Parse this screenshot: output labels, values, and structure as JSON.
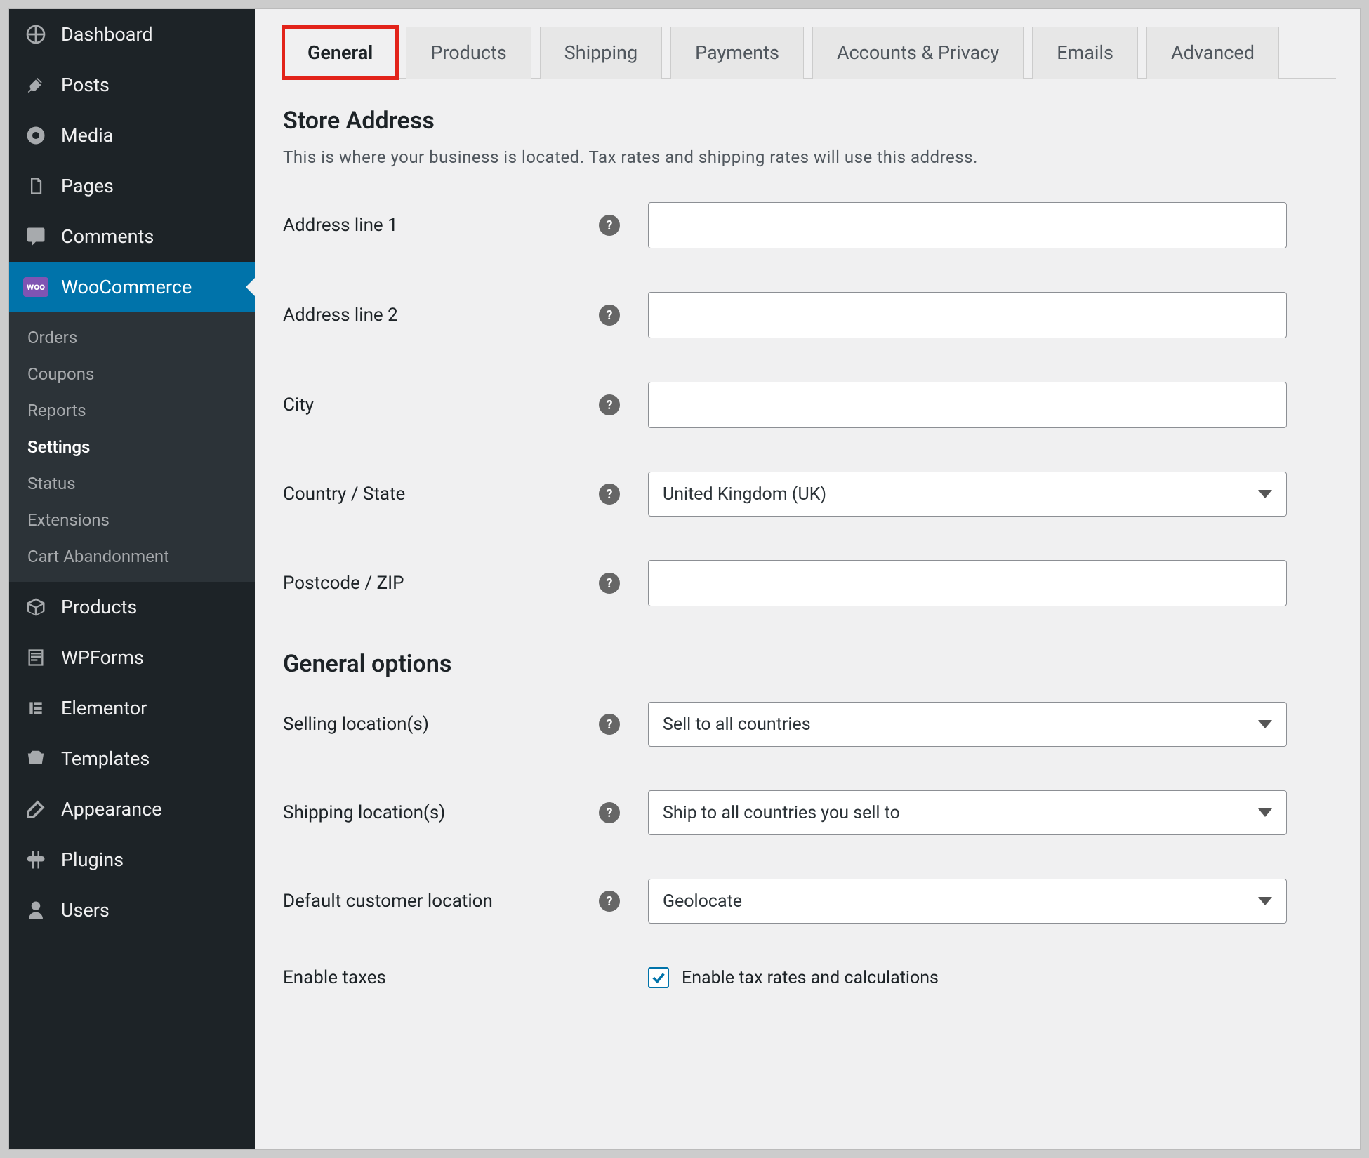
{
  "sidebar": {
    "items": [
      {
        "icon": "dashboard",
        "label": "Dashboard"
      },
      {
        "icon": "pin",
        "label": "Posts"
      },
      {
        "icon": "media",
        "label": "Media"
      },
      {
        "icon": "pages",
        "label": "Pages"
      },
      {
        "icon": "comments",
        "label": "Comments"
      },
      {
        "icon": "woo",
        "label": "WooCommerce",
        "active": true
      },
      {
        "icon": "box",
        "label": "Products"
      },
      {
        "icon": "form",
        "label": "WPForms"
      },
      {
        "icon": "elementor",
        "label": "Elementor"
      },
      {
        "icon": "templates",
        "label": "Templates"
      },
      {
        "icon": "appearance",
        "label": "Appearance"
      },
      {
        "icon": "plugins",
        "label": "Plugins"
      },
      {
        "icon": "users",
        "label": "Users"
      }
    ],
    "submenu": [
      {
        "label": "Orders"
      },
      {
        "label": "Coupons"
      },
      {
        "label": "Reports"
      },
      {
        "label": "Settings",
        "current": true
      },
      {
        "label": "Status"
      },
      {
        "label": "Extensions"
      },
      {
        "label": "Cart Abandonment"
      }
    ]
  },
  "tabs": [
    {
      "label": "General",
      "active": true,
      "highlight": true
    },
    {
      "label": "Products"
    },
    {
      "label": "Shipping"
    },
    {
      "label": "Payments"
    },
    {
      "label": "Accounts & Privacy"
    },
    {
      "label": "Emails"
    },
    {
      "label": "Advanced"
    }
  ],
  "section1": {
    "title": "Store Address",
    "desc": "This is where your business is located. Tax rates and shipping rates will use this address."
  },
  "fields": {
    "addr1": {
      "label": "Address line 1",
      "value": ""
    },
    "addr2": {
      "label": "Address line 2",
      "value": ""
    },
    "city": {
      "label": "City",
      "value": ""
    },
    "country": {
      "label": "Country / State",
      "value": "United Kingdom (UK)"
    },
    "postcode": {
      "label": "Postcode / ZIP",
      "value": ""
    }
  },
  "section2": {
    "title": "General options"
  },
  "options": {
    "selling": {
      "label": "Selling location(s)",
      "value": "Sell to all countries"
    },
    "shipping": {
      "label": "Shipping location(s)",
      "value": "Ship to all countries you sell to"
    },
    "defaultloc": {
      "label": "Default customer location",
      "value": "Geolocate"
    },
    "taxes": {
      "label": "Enable taxes",
      "checkbox_label": "Enable tax rates and calculations",
      "checked": true
    }
  },
  "woo_badge": "woo"
}
